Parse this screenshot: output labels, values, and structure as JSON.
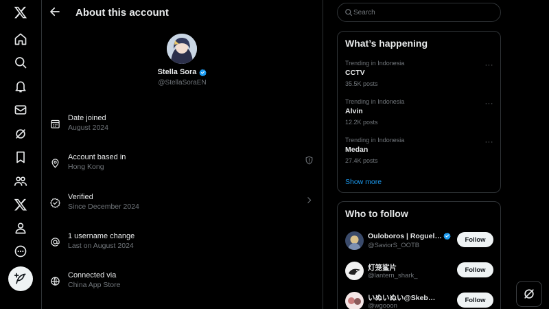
{
  "nav": {
    "items": [
      "x-logo",
      "home",
      "explore",
      "notifications",
      "messages",
      "grok",
      "bookmarks",
      "communities",
      "premium",
      "profile",
      "more",
      "post"
    ]
  },
  "header": {
    "title": "About this account"
  },
  "profile": {
    "name": "Stella Sora",
    "handle": "@StellaSoraEN",
    "verified": true
  },
  "details": [
    {
      "label": "Date joined",
      "value": "August 2024",
      "icon": "calendar-icon"
    },
    {
      "label": "Account based in",
      "value": "Hong Kong",
      "icon": "location-icon"
    },
    {
      "label": "Verified",
      "value": "Since December 2024",
      "icon": "verified-check-icon"
    },
    {
      "label": "1 username change",
      "value": "Last on August 2024",
      "icon": "at-icon"
    },
    {
      "label": "Connected via",
      "value": "China App Store",
      "icon": "globe-icon"
    }
  ],
  "search": {
    "placeholder": "Search"
  },
  "trending": {
    "title": "What’s happening",
    "items": [
      {
        "context": "Trending in Indonesia",
        "name": "CCTV",
        "count": "35.5K posts"
      },
      {
        "context": "Trending in Indonesia",
        "name": "Alvin",
        "count": "12.2K posts"
      },
      {
        "context": "Trending in Indonesia",
        "name": "Medan",
        "count": "27.4K posts"
      }
    ],
    "more_glyph": "···",
    "show_more": "Show more"
  },
  "who_to_follow": {
    "title": "Who to follow",
    "follow_label": "Follow",
    "items": [
      {
        "name": "Ouloboros | Roguelite",
        "handle": "@SaviorS_OOTB",
        "verified": true
      },
      {
        "name": "灯笼鲨片",
        "handle": "@lantern_shark_",
        "verified": false
      },
      {
        "name": "いぬいぬい@Skeb募集中",
        "handle": "@wgooon",
        "verified": false
      }
    ]
  },
  "colors": {
    "background": "#000000",
    "border": "#2f3336",
    "text": "#e7e9ea",
    "muted": "#71767b",
    "accent": "#1d9bf0",
    "button": "#eff3f4"
  }
}
